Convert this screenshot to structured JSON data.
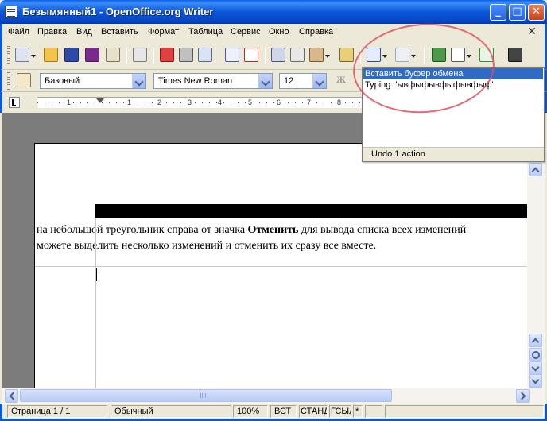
{
  "window": {
    "title": "Безымянный1 - OpenOffice.org Writer",
    "min_glyph": "_",
    "max_glyph": "□",
    "close_glyph": "✕"
  },
  "menu": {
    "items": [
      "Файл",
      "Правка",
      "Вид",
      "Вставить",
      "Формат",
      "Таблица",
      "Сервис",
      "Окно",
      "Справка"
    ],
    "doc_close_glyph": "✕"
  },
  "formatting": {
    "style": "Базовый",
    "font": "Times New Roman",
    "size": "12",
    "bold_glyph": "Ж"
  },
  "ruler": {
    "ticks": [
      "1",
      "1",
      "2",
      "3",
      "4",
      "5",
      "6",
      "7",
      "8"
    ]
  },
  "document": {
    "line1_pre": "на небольшой треугольник справа от значка ",
    "line1_bold": "Отменить",
    "line1_post": " для вывода списка всех изменений",
    "line2": "можете выделить несколько изменений и отменить их сразу все вместе."
  },
  "undo_popup": {
    "items": [
      "Вставить буфер обмена",
      "Typing: 'ывфыфывфыфывфыф'"
    ],
    "footer": "Undo 1 action"
  },
  "status": {
    "page": "Страница  1 / 1",
    "style": "Обычный",
    "zoom": "100%",
    "insert": "ВСТ",
    "std": "СТАНД",
    "sel": "ГСЫЛ",
    "mod": "*"
  },
  "colors": {
    "titlebar": "#0a57d8",
    "selection": "#316ac5",
    "annotation": "#e05060"
  }
}
